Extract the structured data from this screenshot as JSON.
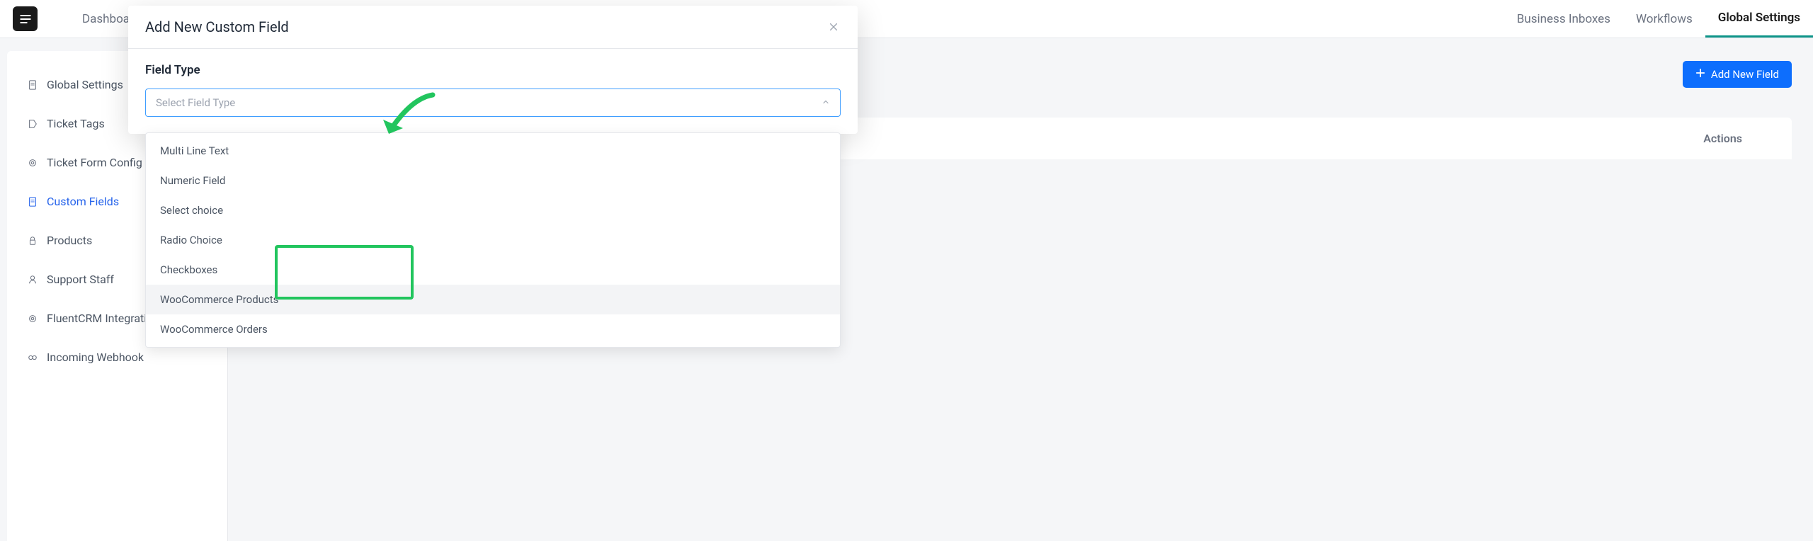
{
  "topnav": {
    "items": [
      "Dashboard"
    ],
    "right_items": [
      "Business Inboxes",
      "Workflows",
      "Global Settings"
    ],
    "active": "Global Settings"
  },
  "sidebar": {
    "items": [
      {
        "label": "Global Settings",
        "icon": "file-icon"
      },
      {
        "label": "Ticket Tags",
        "icon": "tag-icon"
      },
      {
        "label": "Ticket Form Config",
        "icon": "gear-icon"
      },
      {
        "label": "Custom Fields",
        "icon": "file-icon",
        "active": true
      },
      {
        "label": "Products",
        "icon": "lock-icon"
      },
      {
        "label": "Support Staff",
        "icon": "user-icon"
      },
      {
        "label": "FluentCRM Integration",
        "icon": "gear-icon"
      },
      {
        "label": "Incoming Webhook",
        "icon": "link-icon"
      }
    ]
  },
  "main": {
    "add_button": "Add New Field",
    "table_header_actions": "Actions"
  },
  "modal": {
    "title": "Add New Custom Field",
    "field_type_label": "Field Type",
    "select_placeholder": "Select Field Type",
    "options": [
      "Multi Line Text",
      "Numeric Field",
      "Select choice",
      "Radio Choice",
      "Checkboxes",
      "WooCommerce Products",
      "WooCommerce Orders"
    ]
  }
}
